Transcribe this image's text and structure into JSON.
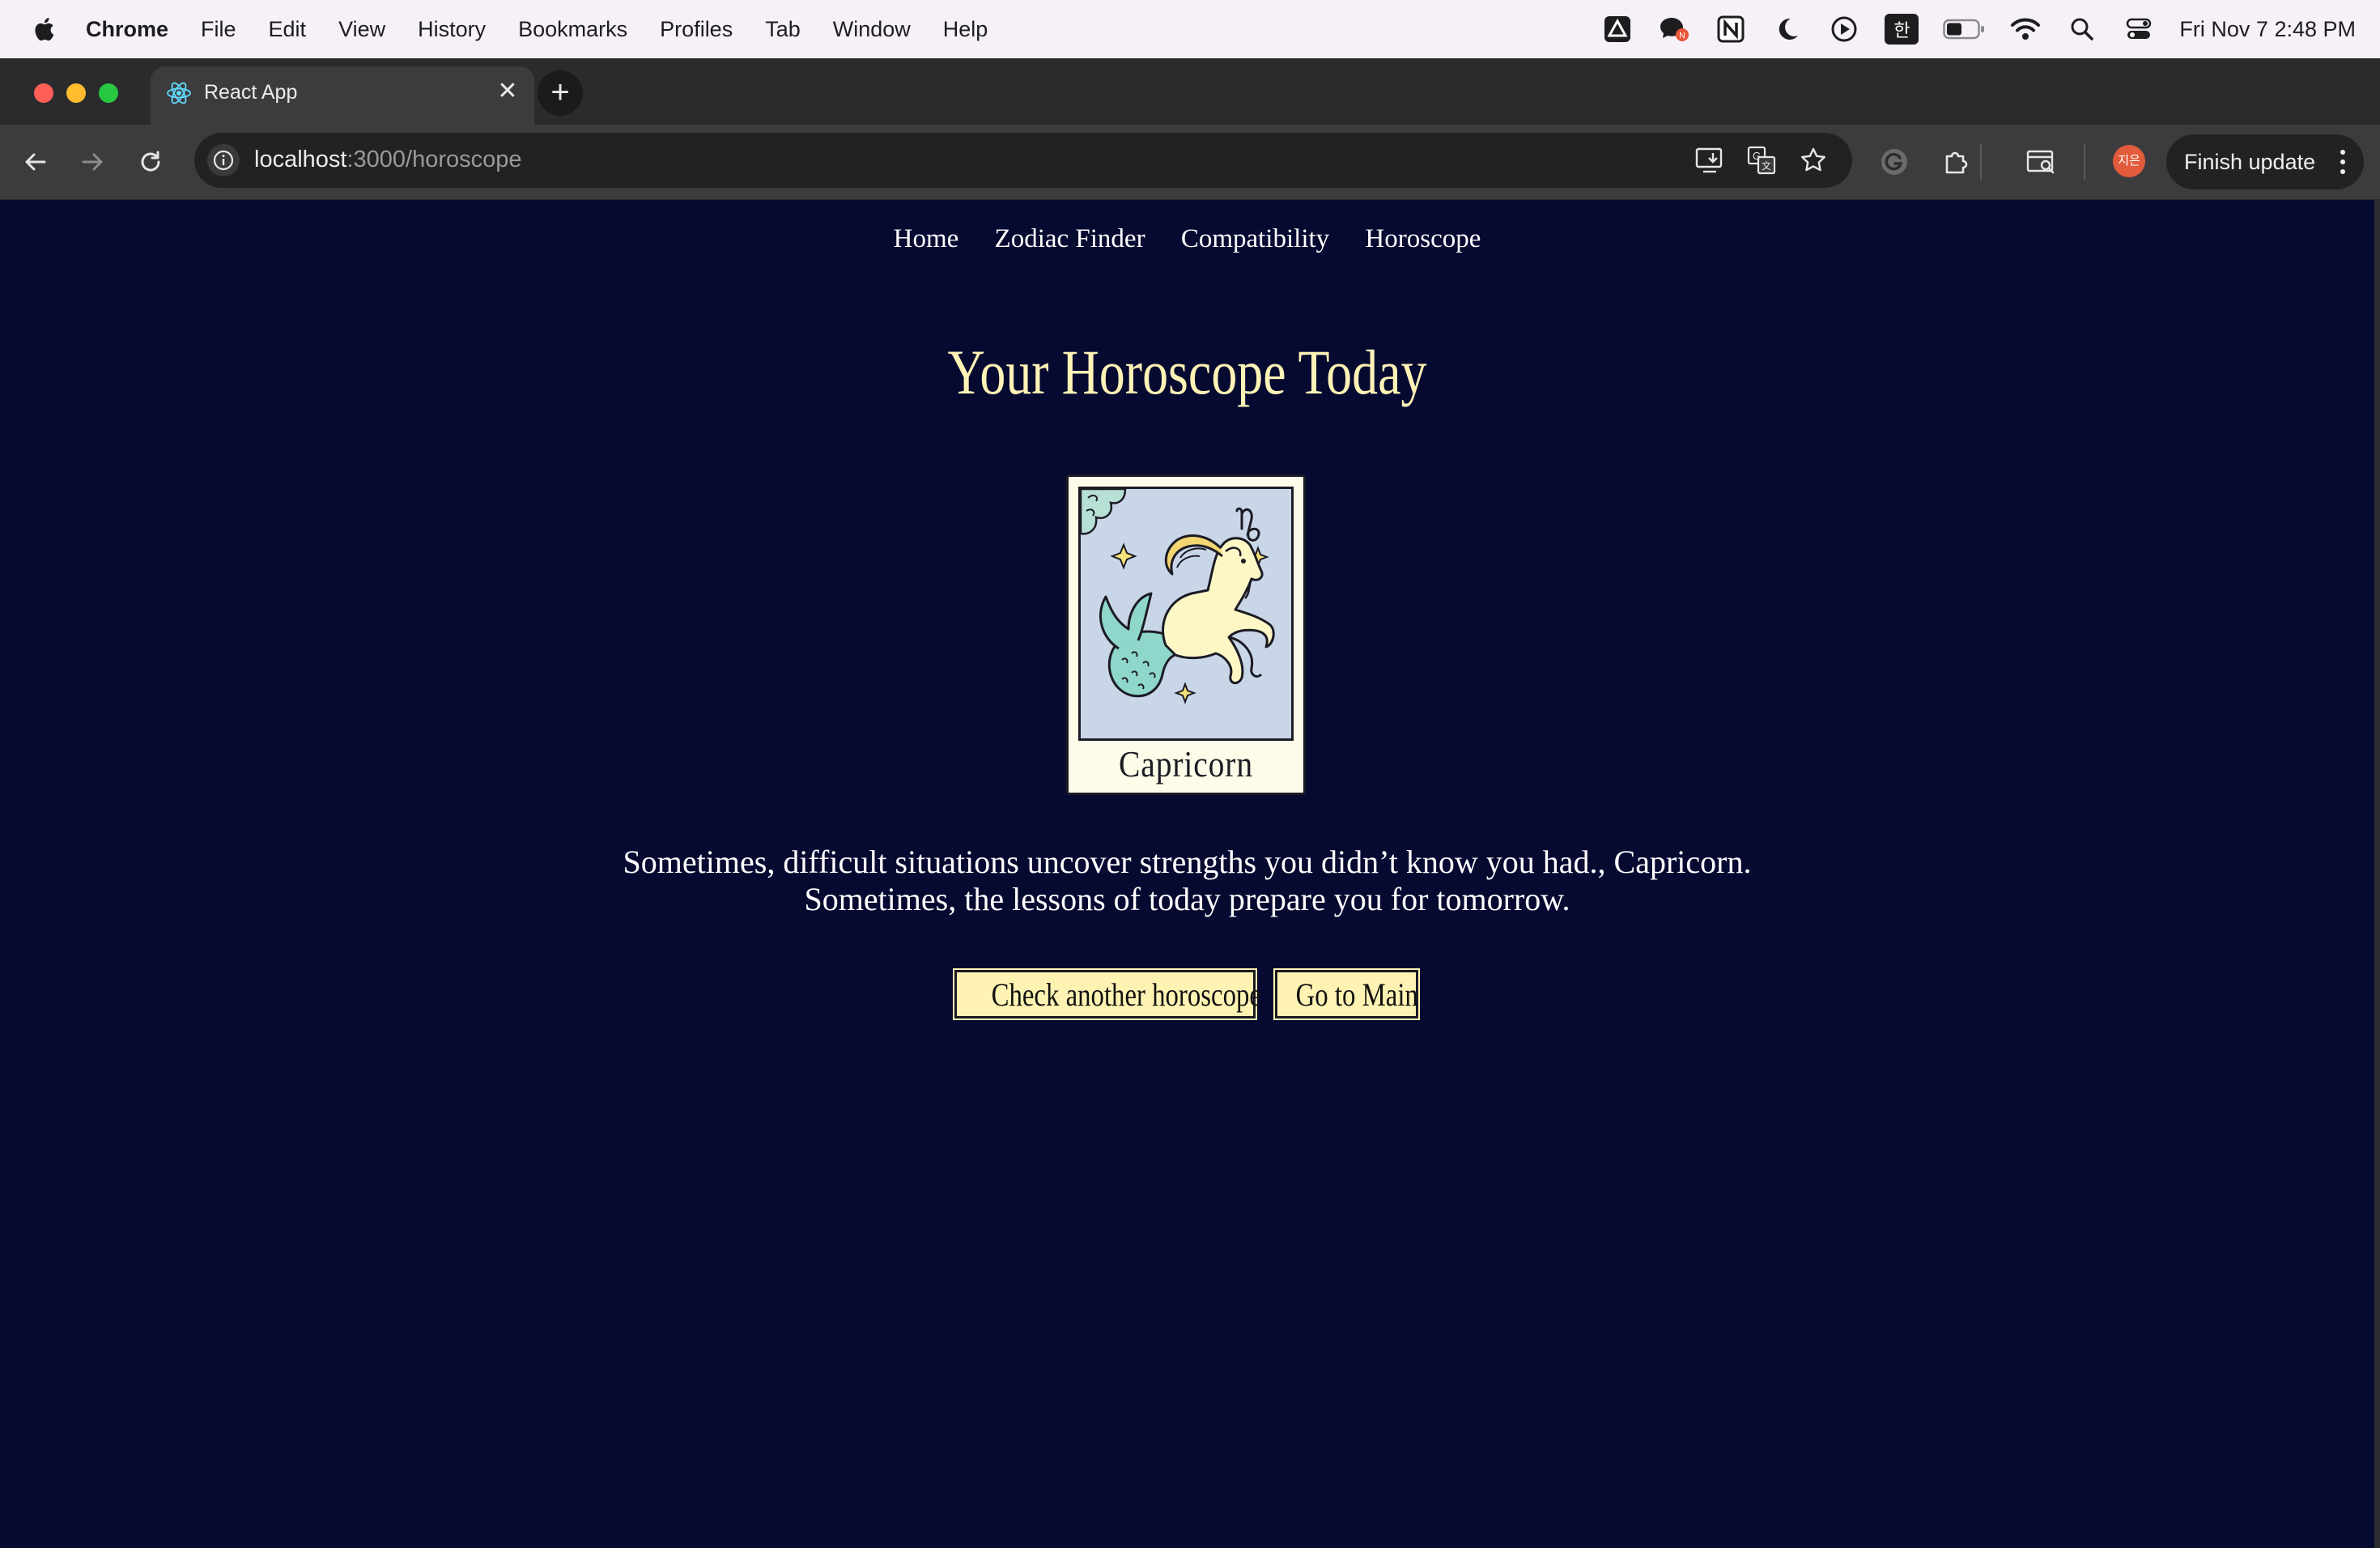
{
  "menubar": {
    "app": "Chrome",
    "items": [
      "File",
      "Edit",
      "View",
      "History",
      "Bookmarks",
      "Profiles",
      "Tab",
      "Window",
      "Help"
    ],
    "input_method": "한",
    "clock": "Fri Nov 7  2:48 PM"
  },
  "browser": {
    "tab_title": "React App",
    "url_host": "localhost",
    "url_path": ":3000/horoscope",
    "profile_initials": "지은",
    "update_label": "Finish update"
  },
  "page": {
    "nav": [
      "Home",
      "Zodiac Finder",
      "Compatibility",
      "Horoscope"
    ],
    "title": "Your Horoscope Today",
    "sign": "Capricorn",
    "message": "Sometimes, difficult situations uncover strengths you didn’t know you had., Capricorn. Sometimes, the lessons of today prepare you for tomorrow.",
    "buttons": {
      "another": "Check another horoscope",
      "main": "Go to Main"
    }
  },
  "colors": {
    "background": "#070a30",
    "title": "#fff3b6",
    "button": "#fff3b3"
  }
}
